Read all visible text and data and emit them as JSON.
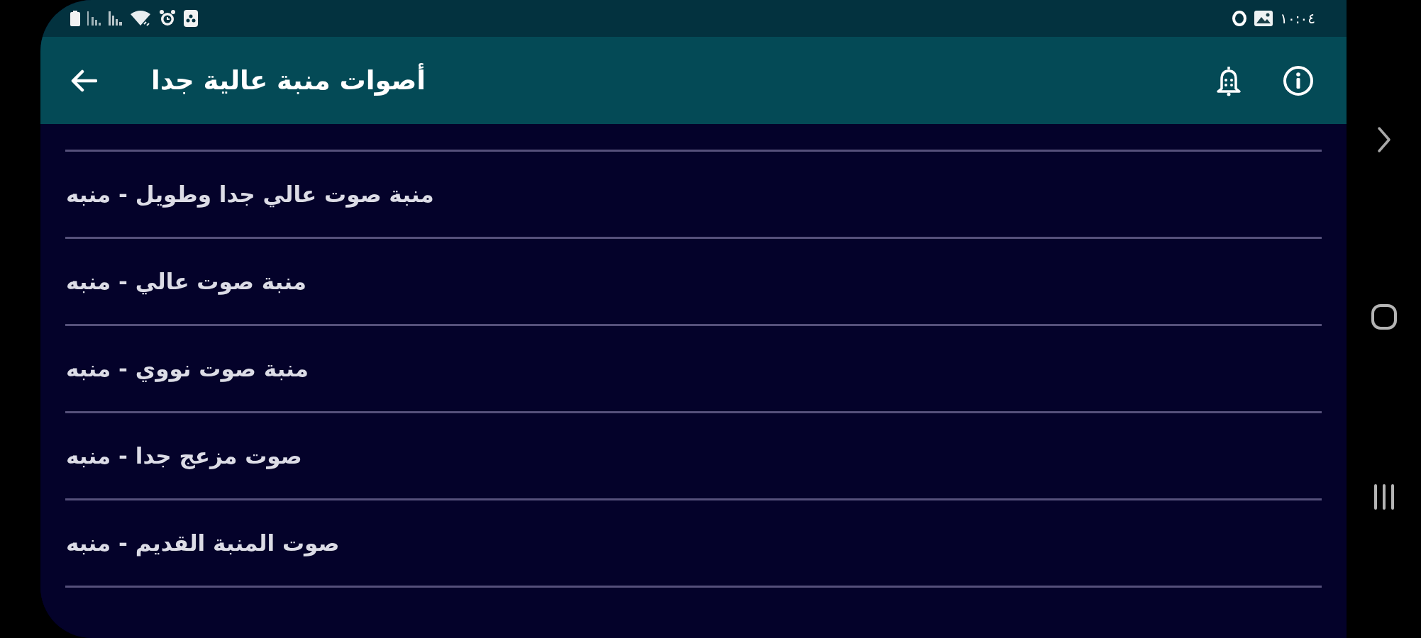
{
  "status_bar": {
    "time": "١٠:٠٤"
  },
  "app_bar": {
    "title": "أصوات منبة عالية جدا"
  },
  "items": [
    {
      "label": "منبة صوت عالي جدا وطويل - منبه"
    },
    {
      "label": "منبة صوت عالي - منبه"
    },
    {
      "label": "منبة صوت نووي - منبه"
    },
    {
      "label": "صوت مزعج جدا - منبه"
    },
    {
      "label": "صوت المنبة القديم - منبه"
    }
  ]
}
